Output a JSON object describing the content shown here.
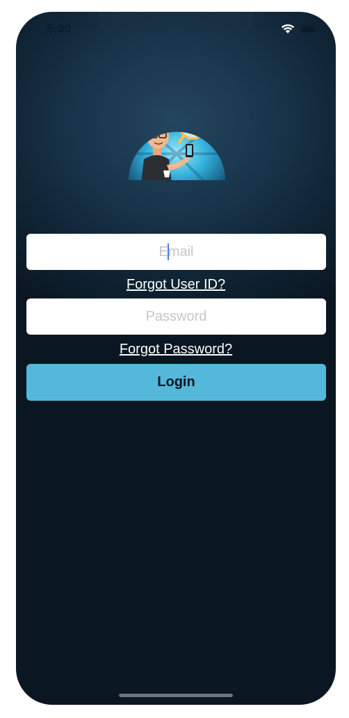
{
  "status_bar": {
    "time": "5:30",
    "signal": "....",
    "icons": [
      "wifi-icon",
      "battery-icon"
    ]
  },
  "logo": {
    "icon": "character-with-magnifier-logo"
  },
  "form": {
    "email": {
      "value": "",
      "placeholder": "Email"
    },
    "forgot_user_id_label": "Forgot User ID?",
    "password": {
      "value": "",
      "placeholder": "Password"
    },
    "forgot_password_label": "Forgot Password?",
    "login_label": "Login"
  },
  "colors": {
    "background_top": "#24465f",
    "background_bottom": "#0a1621",
    "login_button": "#53b8da",
    "link_text": "#ffffff",
    "field_background": "#ffffff"
  }
}
